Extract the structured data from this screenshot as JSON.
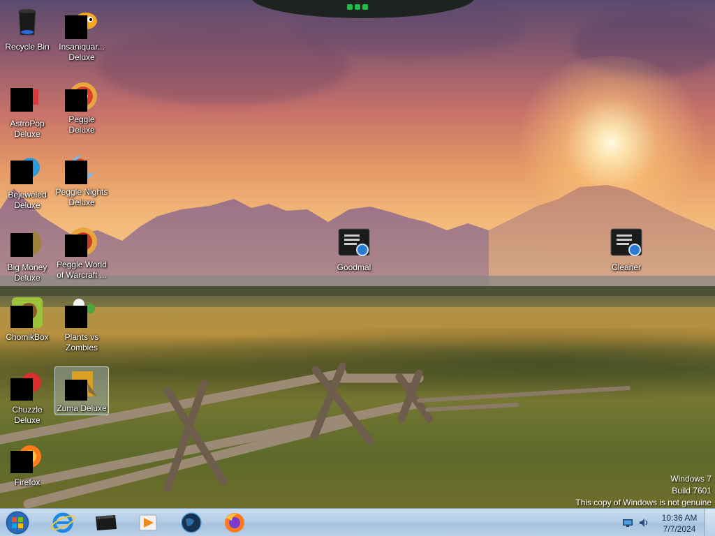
{
  "desktop": {
    "icons": [
      {
        "label": "Recycle Bin",
        "icon": "recycle-bin-icon"
      },
      {
        "label": "Insaniquar... Deluxe",
        "icon": "insaniquarium-icon"
      },
      {
        "label": "AstroPop Deluxe",
        "icon": "astropop-icon"
      },
      {
        "label": "Peggle Deluxe",
        "icon": "peggle-icon"
      },
      {
        "label": "Bejeweled Deluxe",
        "icon": "bejeweled-icon"
      },
      {
        "label": "Peggle Nights Deluxe",
        "icon": "peggle-nights-icon"
      },
      {
        "label": "Big Money Deluxe",
        "icon": "big-money-icon"
      },
      {
        "label": "Peggle World of Warcraft ...",
        "icon": "peggle-wow-icon"
      },
      {
        "label": "ChomikBox",
        "icon": "chomikbox-icon"
      },
      {
        "label": "Plants vs Zombies",
        "icon": "plants-vs-zombies-icon"
      },
      {
        "label": "Chuzzle Deluxe",
        "icon": "chuzzle-icon"
      },
      {
        "label": "Zuma Deluxe",
        "icon": "zuma-icon",
        "selected": true
      },
      {
        "label": "Firefox",
        "icon": "firefox-icon"
      },
      {
        "label": "Goodmal",
        "icon": "goodmal-icon"
      },
      {
        "label": "Cleaner",
        "icon": "cleaner-icon"
      }
    ]
  },
  "watermark": {
    "line1": "Windows 7",
    "line2": "Build 7601",
    "line3": "This copy of Windows is not genuine"
  },
  "taskbar": {
    "pinned": [
      {
        "name": "internet-explorer"
      },
      {
        "name": "windows-media-center"
      },
      {
        "name": "windows-media-player"
      },
      {
        "name": "globe-app"
      },
      {
        "name": "firefox"
      }
    ],
    "clock": {
      "time": "10:36 AM",
      "date": "7/7/2024"
    }
  },
  "colors": {
    "taskbar": "#b4cde6",
    "label_text": "#ffffff",
    "firefox_orange": "#ff7a1a",
    "ie_blue": "#1e88e5"
  }
}
